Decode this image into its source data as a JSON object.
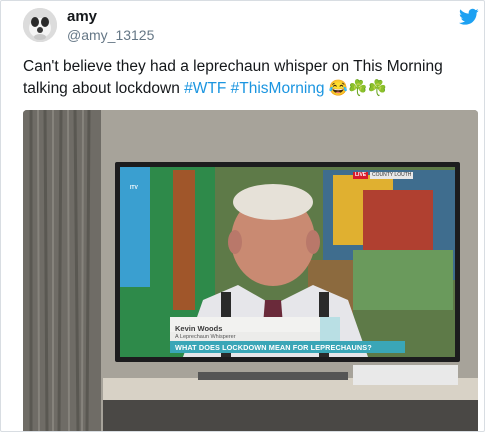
{
  "tweet": {
    "author_name": "amy",
    "author_handle": "@amy_13125",
    "text_parts": [
      {
        "text": "Can't believe they had a leprechaun whisper on This Morning talking about lockdown ",
        "type": "plain"
      },
      {
        "text": "#WTF",
        "type": "hashtag"
      },
      {
        "text": " ",
        "type": "plain"
      },
      {
        "text": "#ThisMorning",
        "type": "hashtag"
      },
      {
        "text": " 😂☘️☘️",
        "type": "plain"
      }
    ],
    "icons": {
      "avatar": "avatar-image",
      "platform": "twitter-bird-icon"
    },
    "colors": {
      "hashtag": "#1b95e0",
      "twitter_blue": "#1da1f2",
      "shamrock": "#77b255"
    }
  },
  "media": {
    "lower_third_name": "Kevin Woods",
    "lower_third_subtitle": "A Leprechaun Whisperer",
    "lower_third_strap": "WHAT DOES LOCKDOWN MEAN FOR LEPRECHAUNS?",
    "live_badge": "LIVE",
    "location_badge": "COUNTY LOUTH",
    "channel_logo": "ITV"
  }
}
